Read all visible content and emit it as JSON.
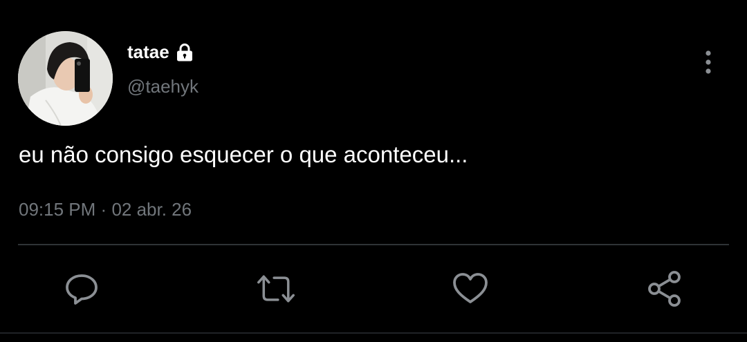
{
  "tweet": {
    "author": {
      "display_name": "tatae",
      "handle": "@taehyk",
      "protected_icon": "lock-icon",
      "avatar": "profile-photo"
    },
    "text": "eu não consigo esquecer o que aconteceu...",
    "time": "09:15 PM",
    "separator": "·",
    "date": "02 abr. 26",
    "menu_icon": "more-vertical-icon"
  },
  "actions": [
    {
      "name": "reply",
      "icon": "comment-icon"
    },
    {
      "name": "retweet",
      "icon": "retweet-icon"
    },
    {
      "name": "like",
      "icon": "heart-icon"
    },
    {
      "name": "share",
      "icon": "share-icon"
    }
  ],
  "colors": {
    "background": "#000000",
    "primary_text": "#ffffff",
    "secondary_text": "#71767b",
    "divider": "#2f3336"
  }
}
